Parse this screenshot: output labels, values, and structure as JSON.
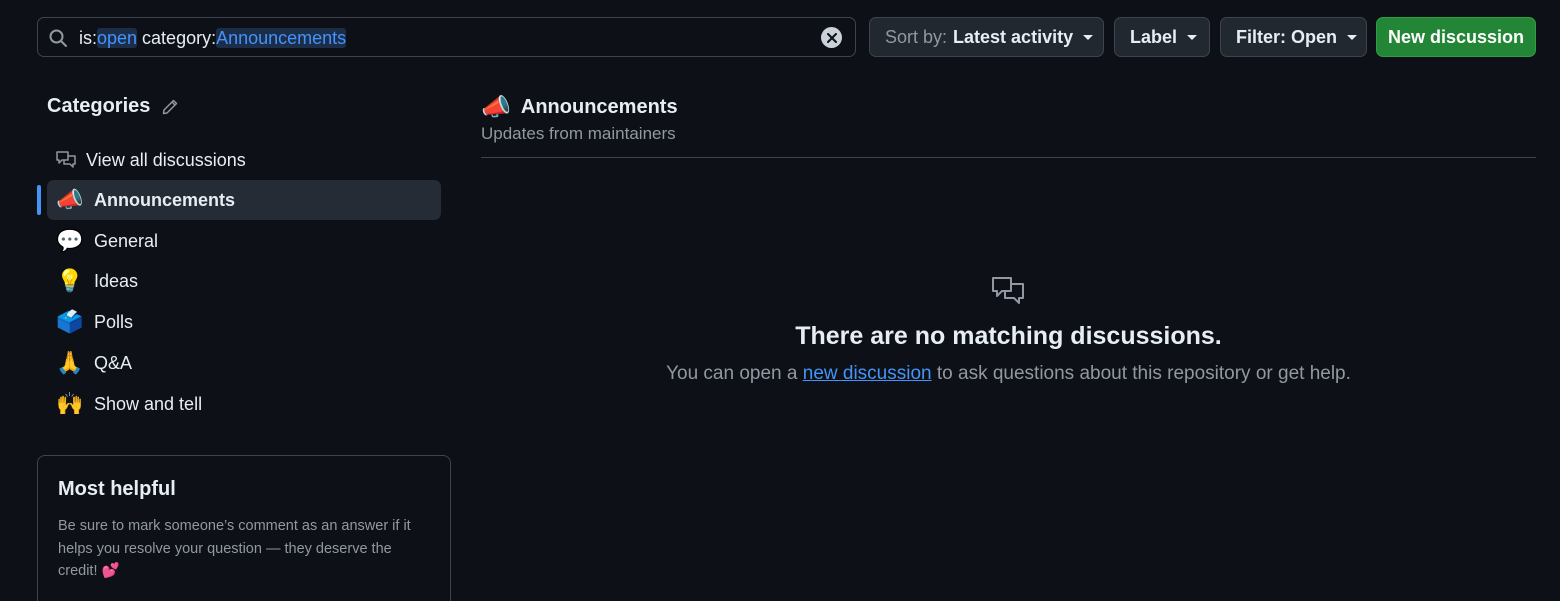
{
  "search": {
    "prefix_is": "is:",
    "value_is": "open",
    "prefix_category": " category:",
    "value_category": "Announcements",
    "icon": "search-icon",
    "clear_icon": "clear-icon"
  },
  "toolbar": {
    "sort_prefix": "Sort by:",
    "sort_value": "Latest activity",
    "label": "Label",
    "filter": "Filter: Open",
    "new_discussion": "New discussion"
  },
  "sidebar": {
    "heading": "Categories",
    "view_all": "View all discussions",
    "items": [
      {
        "emoji": "📣",
        "label": "Announcements",
        "active": true
      },
      {
        "emoji": "💬",
        "label": "General"
      },
      {
        "emoji": "💡",
        "label": "Ideas"
      },
      {
        "emoji": "🗳️",
        "label": "Polls"
      },
      {
        "emoji": "🙏",
        "label": "Q&A"
      },
      {
        "emoji": "🙌",
        "label": "Show and tell"
      }
    ]
  },
  "helpful": {
    "title": "Most helpful",
    "text": "Be sure to mark someone’s comment as an answer if it helps you resolve your question — they deserve the credit! 💕"
  },
  "main": {
    "emoji": "📣",
    "title": "Announcements",
    "subtitle": "Updates from maintainers",
    "empty_title": "There are no matching discussions.",
    "empty_before": "You can open a ",
    "empty_link": "new discussion",
    "empty_after": " to ask questions about this repository or get help."
  },
  "colors": {
    "background": "#0d1117",
    "accent": "#4493f8",
    "primary_button": "#238636"
  }
}
